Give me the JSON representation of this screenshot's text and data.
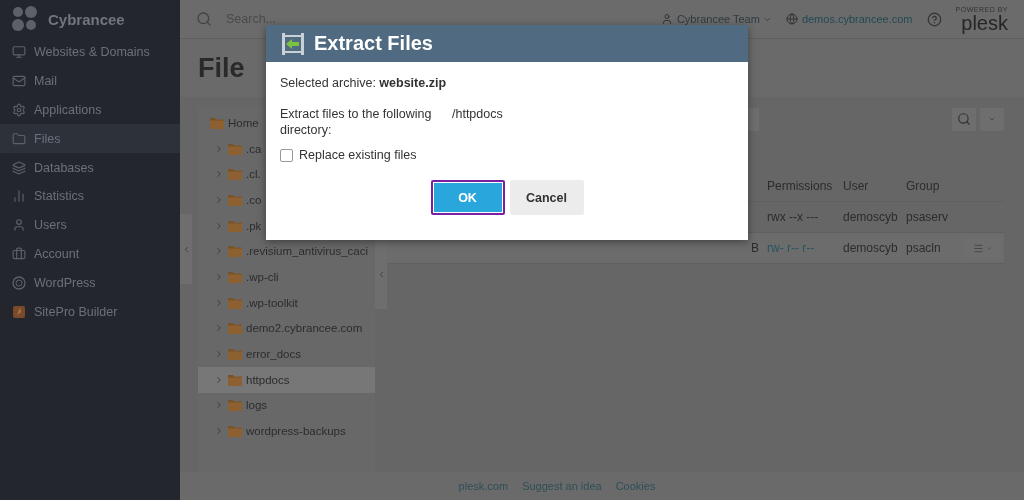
{
  "sidebar": {
    "brand": "Cybrancee",
    "items": [
      {
        "label": "Websites & Domains",
        "selected": false
      },
      {
        "label": "Mail",
        "selected": false
      },
      {
        "label": "Applications",
        "selected": false
      },
      {
        "label": "Files",
        "selected": true
      },
      {
        "label": "Databases",
        "selected": false
      },
      {
        "label": "Statistics",
        "selected": false
      },
      {
        "label": "Users",
        "selected": false
      },
      {
        "label": "Account",
        "selected": false
      },
      {
        "label": "WordPress",
        "selected": false
      },
      {
        "label": "SitePro Builder",
        "selected": false
      }
    ]
  },
  "topbar": {
    "search_placeholder": "Search...",
    "user": "Cybrancee Team",
    "domain": "demos.cybrancee.com",
    "logo_caption": "POWERED BY",
    "logo": "plesk"
  },
  "page_title": "File",
  "tree": {
    "root": "Home",
    "items": [
      {
        "label": ".ca",
        "selected": false
      },
      {
        "label": ".cl.",
        "selected": false
      },
      {
        "label": ".co",
        "selected": false
      },
      {
        "label": ".pk",
        "selected": false
      },
      {
        "label": ".revisium_antivirus_caci",
        "selected": false
      },
      {
        "label": ".wp-cli",
        "selected": false
      },
      {
        "label": ".wp-toolkit",
        "selected": false
      },
      {
        "label": "demo2.cybrancee.com",
        "selected": false
      },
      {
        "label": "error_docs",
        "selected": false
      },
      {
        "label": "httpdocs",
        "selected": true
      },
      {
        "label": "logs",
        "selected": false
      },
      {
        "label": "wordpress-backups",
        "selected": false
      }
    ]
  },
  "table": {
    "columns": [
      "Permissions",
      "User",
      "Group"
    ],
    "rows": [
      {
        "size": "",
        "permissions": "rwx --x ---",
        "user": "demoscyb",
        "group": "psaserv",
        "selected": false,
        "menu": false
      },
      {
        "size": "B",
        "permissions": "rw- r-- r--",
        "user": "demoscyb",
        "group": "psacln",
        "selected": true,
        "menu": true
      }
    ]
  },
  "dialog": {
    "title": "Extract Files",
    "archive": "Selected archive: **website.zip**",
    "directory_label": "Extract files to the following directory:",
    "directory": "/httpdocs",
    "replace": {
      "label": "Replace existing files",
      "checked": false
    },
    "buttons": [
      {
        "label": "OK",
        "kind": "primary",
        "focused": true
      },
      {
        "label": "Cancel",
        "kind": "secondary",
        "focused": false
      }
    ]
  },
  "footer": {
    "links": [
      "plesk.com",
      "Suggest an idea",
      "Cookies"
    ]
  }
}
